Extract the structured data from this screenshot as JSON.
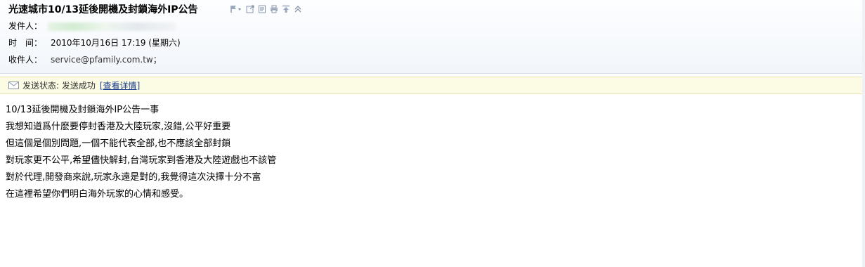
{
  "email": {
    "subject": "光速城市10/13延後開機及封鎖海外IP公告",
    "toolbar_icons": [
      "flag-dropdown-icon",
      "open-new-window-icon",
      "edit-note-icon",
      "print-icon",
      "pin-top-icon",
      "collapse-icon"
    ],
    "sender_label": "发件人：",
    "time_label": "时　间：",
    "time_value": "2010年10月16日 17:19 (星期六)",
    "recipient_label": "收件人：",
    "recipient_value": "service@pfamily.com.tw；"
  },
  "status": {
    "text": "发送状态: 发送成功",
    "link_open": "[",
    "link_label": "查看详情",
    "link_close": "]",
    "icon": "envelope-icon"
  },
  "body_lines": [
    "10/13延後開機及封鎖海外IP公告一事",
    "我想知道爲什麽要停封香港及大陸玩家,沒錯,公平好重要",
    "但這個是個別問題,一個不能代表全部,也不應該全部封鎖",
    "對玩家更不公平,希望儘快解封,台灣玩家到香港及大陸遊戲也不該管",
    "對於代理,開發商來說,玩家永遠是對的,我覺得這次決擇十分不富",
    "在這裡希望你們明白海外玩家的心情和感受。"
  ],
  "colors": {
    "header_bg": "#f2f6fb",
    "status_bg": "#fcfbe4",
    "link": "#1a3f8f"
  }
}
